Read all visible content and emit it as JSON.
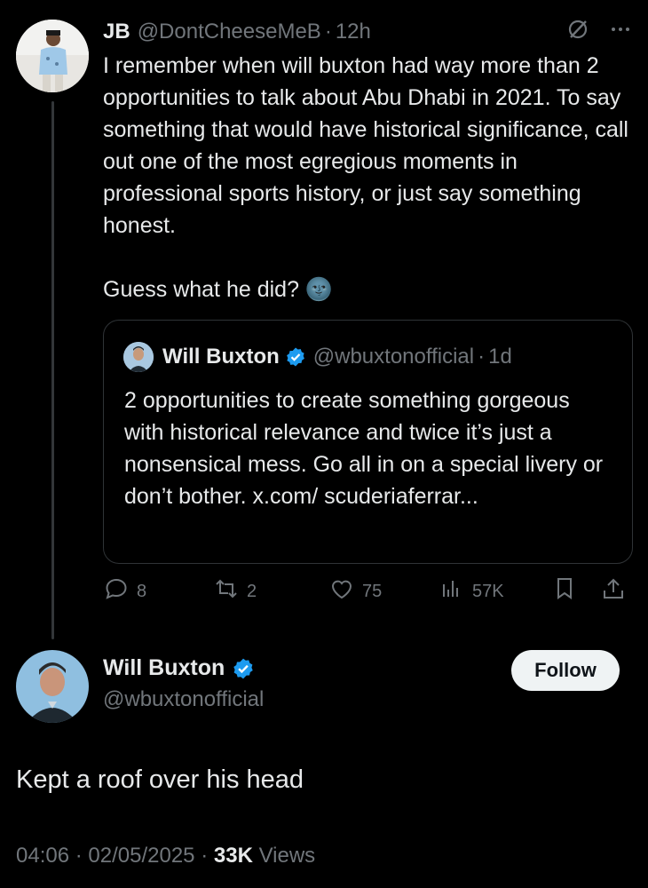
{
  "parent": {
    "name": "JB",
    "handle": "@DontCheeseMeB",
    "time": "12h",
    "text": "I remember when will buxton had way more than 2 opportunities to talk about Abu Dhabi in 2021. To say something that would have historical significance, call out one of the most egregious moments in professional sports history, or just say something honest.\n\nGuess what he did? 🌚",
    "grok_icon": "slash-circle-icon",
    "more_icon": "more-icon"
  },
  "quote": {
    "name": "Will Buxton",
    "handle": "@wbuxtonofficial",
    "time": "1d",
    "text": "2 opportunities to create something gorgeous with historical relevance and twice it’s just a nonsensical mess. Go all in on a special livery or don’t bother. x.com/ scuderiaferrar..."
  },
  "actions": {
    "replies": "8",
    "reposts": "2",
    "likes": "75",
    "views": "57K"
  },
  "main": {
    "name": "Will Buxton",
    "handle": "@wbuxtonofficial",
    "follow_label": "Follow",
    "text": "Kept a roof over his head",
    "time": "04:06",
    "date": "02/05/2025",
    "views_count": "33K",
    "views_label": "Views"
  },
  "colors": {
    "background": "#000000",
    "text": "#e7e9ea",
    "muted": "#71767b",
    "verified": "#1d9bf0",
    "border": "#2f3336"
  }
}
